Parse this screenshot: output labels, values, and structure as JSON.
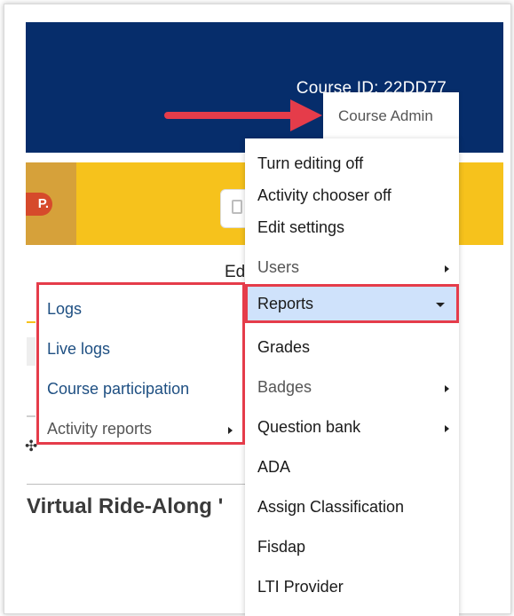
{
  "header": {
    "course_id": "Course ID: 22DD77"
  },
  "banner": {
    "logo_text": "P."
  },
  "page": {
    "partial_heading": "Ed",
    "section_title": "Virtual Ride-Along '"
  },
  "course_admin": {
    "trigger_label": "Course Admin",
    "items": [
      {
        "label": "Turn editing off",
        "submenu": false,
        "muted": false
      },
      {
        "label": "Activity chooser off",
        "submenu": false,
        "muted": false
      },
      {
        "label": "Edit settings",
        "submenu": false,
        "muted": false
      },
      {
        "label": "Users",
        "submenu": true,
        "muted": true
      },
      {
        "label": "Reports",
        "submenu": true,
        "muted": false,
        "expanded": true
      },
      {
        "label": "Grades",
        "submenu": false,
        "muted": false
      },
      {
        "label": "Badges",
        "submenu": true,
        "muted": true
      },
      {
        "label": "Question bank",
        "submenu": true,
        "muted": false
      },
      {
        "label": "ADA",
        "submenu": false,
        "muted": false
      },
      {
        "label": "Assign Classification",
        "submenu": false,
        "muted": false
      },
      {
        "label": "Fisdap",
        "submenu": false,
        "muted": false
      },
      {
        "label": "LTI Provider",
        "submenu": false,
        "muted": false
      }
    ]
  },
  "reports_submenu": {
    "items": [
      {
        "label": "Logs"
      },
      {
        "label": "Live logs"
      },
      {
        "label": "Course participation"
      },
      {
        "label": "Activity reports"
      }
    ]
  },
  "colors": {
    "header_navy": "#062d6b",
    "banner_yellow": "#f6c21c",
    "highlight_blue": "#cfe2fb",
    "annotation_red": "#e53c4a",
    "link_blue": "#1e4f82"
  }
}
